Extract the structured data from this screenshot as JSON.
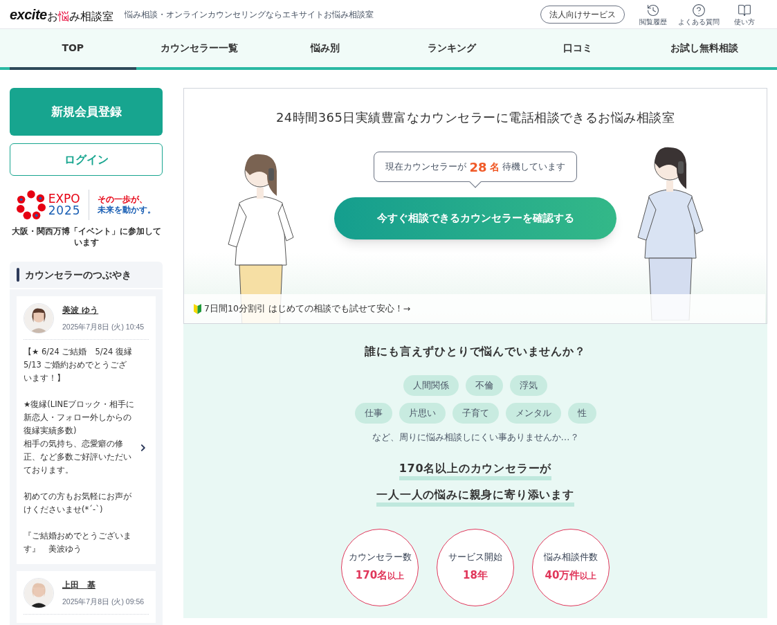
{
  "header": {
    "logo": {
      "brand": "excite",
      "parts": [
        {
          "text": "お",
          "accent": false
        },
        {
          "text": "悩",
          "accent": true
        },
        {
          "text": "み相談室",
          "accent": false
        }
      ]
    },
    "tagline": "悩み相談・オンラインカウンセリングならエキサイトお悩み相談室",
    "corporate_button": "法人向けサービス",
    "tools": [
      {
        "kind": "history",
        "label": "閲覧履歴"
      },
      {
        "kind": "help",
        "label": "よくある質問"
      },
      {
        "kind": "guide",
        "label": "使い方"
      }
    ]
  },
  "nav": [
    {
      "label": "TOP",
      "selected": true
    },
    {
      "label": "カウンセラー一覧",
      "selected": false
    },
    {
      "label": "悩み別",
      "selected": false
    },
    {
      "label": "ランキング",
      "selected": false
    },
    {
      "label": "口コミ",
      "selected": false
    },
    {
      "label": "お試し無料相談",
      "selected": false
    }
  ],
  "sidebar": {
    "register_button": "新規会員登録",
    "login_button": "ログイン",
    "expo": {
      "word": "EXPO",
      "year": "2025",
      "slogan_1": "その一歩が、",
      "slogan_2": "未来を動かす。",
      "caption": "大阪・関西万博「イベント」に参加しています"
    },
    "posts_title": "カウンセラーのつぶやき",
    "posts": [
      {
        "name": "美波 ゆう",
        "date": "2025年7月8日 (火) 10:45",
        "paragraphs": [
          [
            "【★ 6/24 ご結婚　5/24 復縁 5/13 ご婚約おめでとうございます！】"
          ],
          [
            "★復縁(LINEブロック・相手に新恋人・フォロー外しからの復縁実績多数)",
            "相手の気持ち、恋愛癖の修正、など多数ご好評いただいております。"
          ],
          [
            "初めての方もお気軽にお声がけくださいませ(*´-`)"
          ],
          [
            "『ご結婚おめでとうございます』　美波ゆう"
          ]
        ]
      },
      {
        "name": "上田　基",
        "date": "2025年7月8日 (火) 09:56"
      }
    ]
  },
  "hero": {
    "title": "24時間365日実績豊富なカウンセラーに電話相談できるお悩み相談室",
    "bubble_before": "現在カウンセラーが",
    "bubble_count": "28",
    "bubble_unit": "名",
    "bubble_after": "待機しています",
    "cta": "今すぐ相談できるカウンセラーを確認する",
    "promo": "7日間10分割引 はじめての相談でも試せて安心！→"
  },
  "intro": {
    "question": "誰にも言えずひとりで悩んでいませんか？",
    "tag_rows": [
      [
        "人間関係",
        "不倫",
        "浮気"
      ],
      [
        "仕事",
        "片思い",
        "子育て",
        "メンタル",
        "性"
      ]
    ],
    "note": "など、周りに悩み相談しにくい事ありませんか…？",
    "lead_1": "170名以上のカウンセラーが",
    "lead_2": "一人一人の悩みに親身に寄り添います",
    "stats": [
      {
        "label": "カウンセラー数",
        "value": "170名",
        "suffix": "以上"
      },
      {
        "label": "サービス開始",
        "value": "18年"
      },
      {
        "label": "悩み相談件数",
        "value": "40万件",
        "suffix": "以上"
      }
    ]
  }
}
